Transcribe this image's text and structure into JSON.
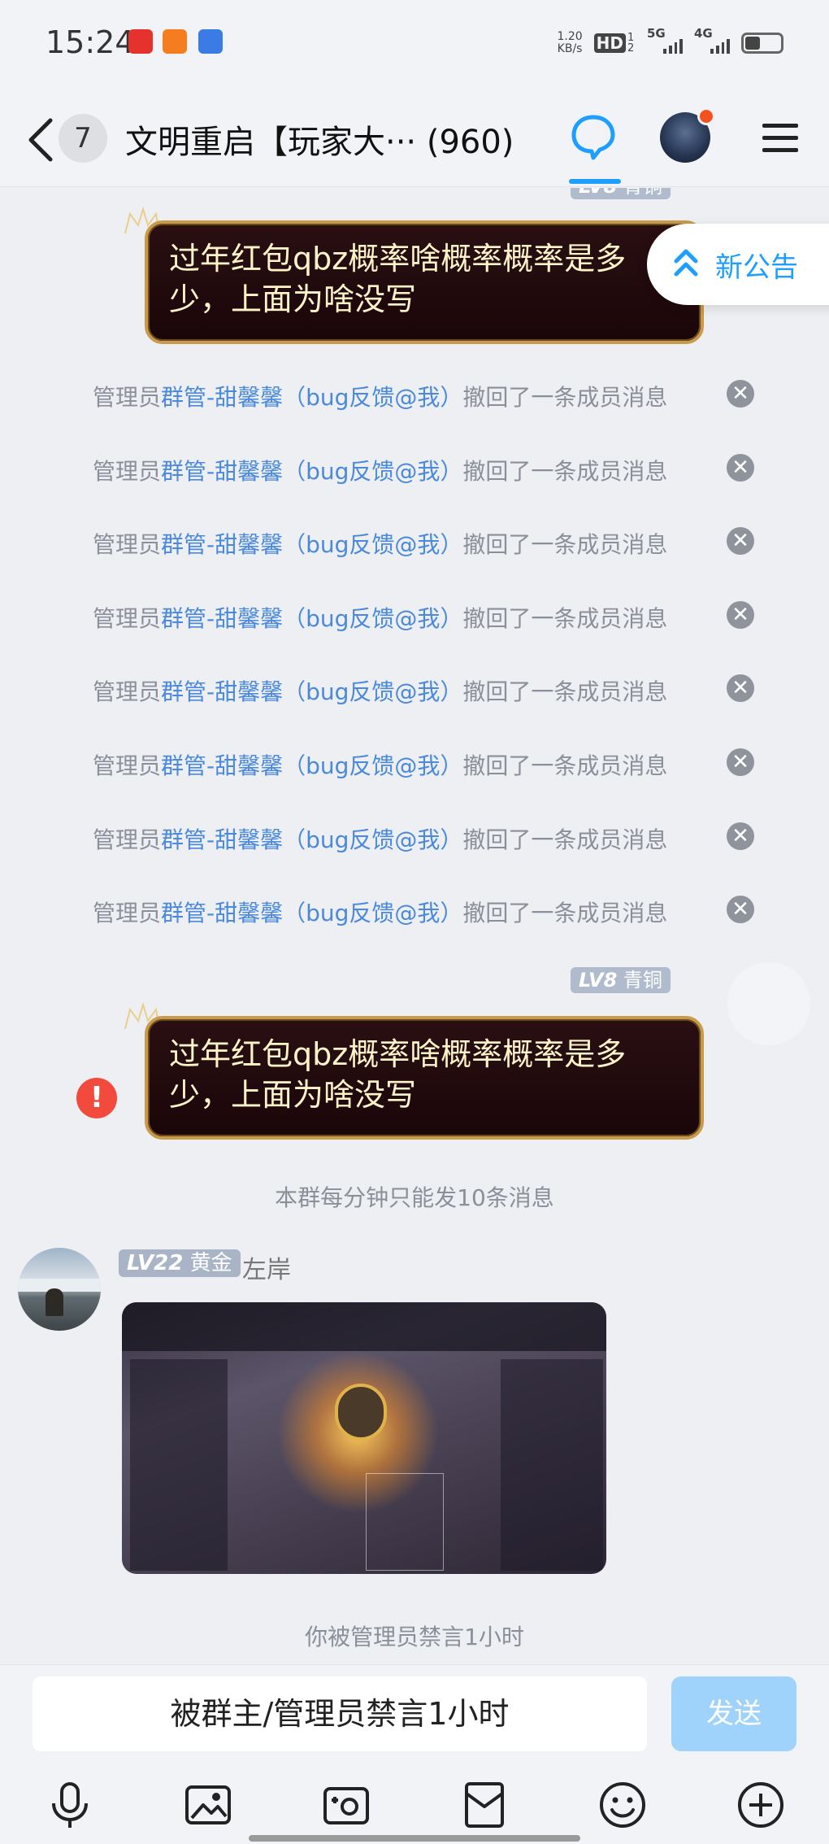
{
  "status_bar": {
    "time": "15:24",
    "net_speed_value": "1.20",
    "net_speed_unit": "KB/s",
    "hd_label": "HD",
    "hd_sub": "1 2",
    "sig1_label": "5G",
    "sig2_label": "4G"
  },
  "header": {
    "unread_count": "7",
    "title": "文明重启【玩家大··· (960)"
  },
  "announcement": {
    "label": "新公告"
  },
  "messages": {
    "bubble_text": "过年红包qbz概率啥概率概率是多少，上面为啥没写",
    "level_tag_prefix": "LV8",
    "level_tag_rank": "青铜",
    "recall_prefix": "管理员",
    "recall_name": "群管-甜馨馨（bug反馈@我）",
    "recall_suffix": "撤回了一条成员消息",
    "rate_limit_notice": "本群每分钟只能发10条消息",
    "user_level_prefix": "LV22",
    "user_level_rank": "黄金",
    "user_name": "左岸",
    "muted_notice": "你被管理员禁言1小时"
  },
  "input": {
    "text": "被群主/管理员禁言1小时",
    "send_label": "发送"
  },
  "colors": {
    "accent": "#1e9fff",
    "link_name": "#4a89dc",
    "bubble_bg": "#1a0609",
    "bubble_border": "#c89a4a",
    "error": "#f24a3d"
  },
  "icons": [
    "back-icon",
    "chat-icon",
    "menu-icon",
    "close-icon",
    "error-icon",
    "chevron-up-icon",
    "microphone-icon",
    "image-icon",
    "camera-icon",
    "red-packet-icon",
    "emoji-icon",
    "plus-icon"
  ]
}
